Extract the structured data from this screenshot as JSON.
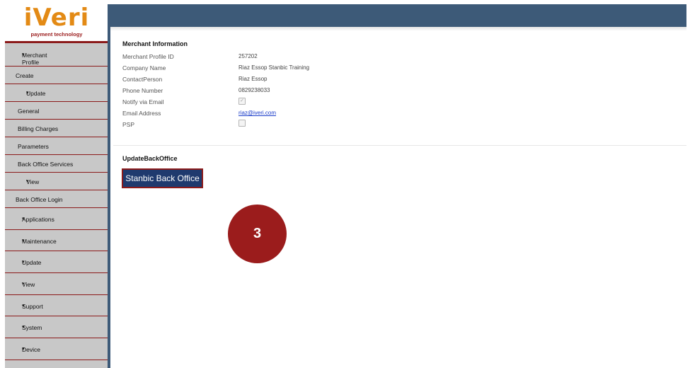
{
  "logo": {
    "brand": "iVeri",
    "tagline": "payment technology"
  },
  "sidebar": {
    "items": [
      {
        "label": "Merchant Profile",
        "caret": "▾"
      },
      {
        "label": "Create"
      },
      {
        "label": "Update",
        "caret": "▾"
      },
      {
        "label": "General"
      },
      {
        "label": "Billing Charges"
      },
      {
        "label": "Parameters"
      },
      {
        "label": "Back Office Services"
      },
      {
        "label": "View",
        "caret": "▾"
      },
      {
        "label": "Back Office Login"
      },
      {
        "label": "Applications",
        "caret": "▾"
      },
      {
        "label": "Maintenance",
        "caret": "▾"
      },
      {
        "label": "Update",
        "caret": "▾"
      },
      {
        "label": "View",
        "caret": "▾"
      },
      {
        "label": "Support",
        "caret": "▾"
      },
      {
        "label": "System",
        "caret": "▾"
      },
      {
        "label": "Device",
        "caret": "▾"
      }
    ]
  },
  "merchant_info": {
    "title": "Merchant Information",
    "fields": [
      {
        "label": "Merchant Profile ID",
        "value": "257202"
      },
      {
        "label": "Company Name",
        "value": "Riaz Essop Stanbic Training"
      },
      {
        "label": "ContactPerson",
        "value": "Riaz Essop"
      },
      {
        "label": "Phone Number",
        "value": "0829238033"
      },
      {
        "label": "Notify via Email",
        "checked": true
      },
      {
        "label": "Email Address",
        "value": "riaz@iveri.com"
      },
      {
        "label": "PSP",
        "checked": false
      }
    ]
  },
  "update_back_office": {
    "title": "UpdateBackOffice",
    "button_label": "Stanbic Back Office"
  },
  "step_badge": "3",
  "colors": {
    "topbar": "#3d5a78",
    "sidebar_bg": "#c8c8c8",
    "accent_red": "#8b1a1a",
    "button_bg": "#1f3a6e",
    "badge": "#9b1c1c",
    "logo_orange": "#e38a15"
  }
}
